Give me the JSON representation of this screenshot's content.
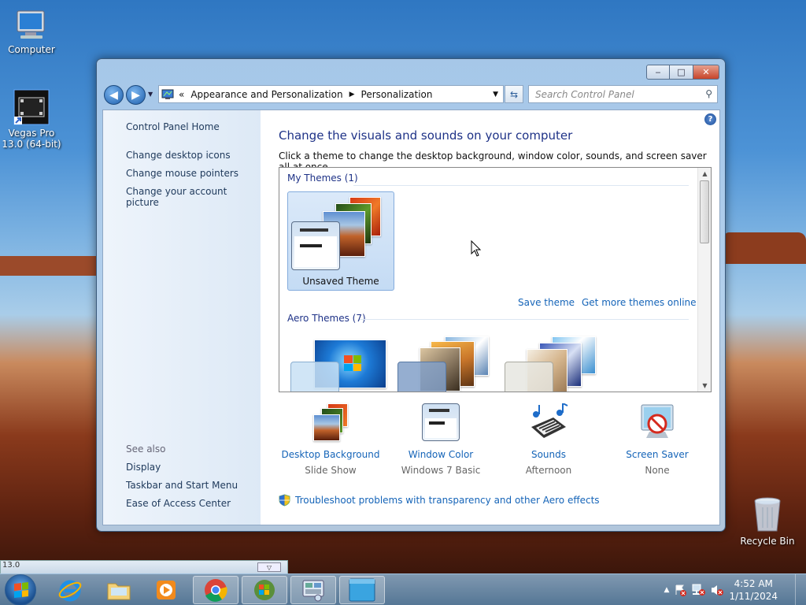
{
  "desktop": {
    "icons": [
      {
        "label": "Computer"
      },
      {
        "label": "Vegas Pro 13.0 (64-bit)"
      },
      {
        "label": "Recycle Bin"
      }
    ]
  },
  "window": {
    "caption_buttons": {
      "minimize": "‒",
      "maximize": "□",
      "close": "✕"
    },
    "address": {
      "prefix": "«",
      "segments": [
        "Appearance and Personalization",
        "Personalization"
      ]
    },
    "search_placeholder": "Search Control Panel",
    "left_pane": {
      "home": "Control Panel Home",
      "tasks": [
        "Change desktop icons",
        "Change mouse pointers",
        "Change your account picture"
      ],
      "see_also_heading": "See also",
      "see_also": [
        "Display",
        "Taskbar and Start Menu",
        "Ease of Access Center"
      ]
    },
    "main": {
      "title": "Change the visuals and sounds on your computer",
      "subtitle": "Click a theme to change the desktop background, window color, sounds, and screen saver all at once.",
      "groups": {
        "my_themes": "My Themes (1)",
        "aero_themes": "Aero Themes (7)"
      },
      "selected_theme": "Unsaved Theme",
      "save_theme": "Save theme",
      "get_more": "Get more themes online",
      "options": [
        {
          "title": "Desktop Background",
          "value": "Slide Show"
        },
        {
          "title": "Window Color",
          "value": "Windows 7 Basic"
        },
        {
          "title": "Sounds",
          "value": "Afternoon"
        },
        {
          "title": "Screen Saver",
          "value": "None"
        }
      ],
      "troubleshoot": "Troubleshoot problems with transparency and other Aero effects"
    }
  },
  "taskbar": {
    "preview_label": "13.0",
    "clock_time": "4:52 AM",
    "clock_date": "1/11/2024"
  }
}
